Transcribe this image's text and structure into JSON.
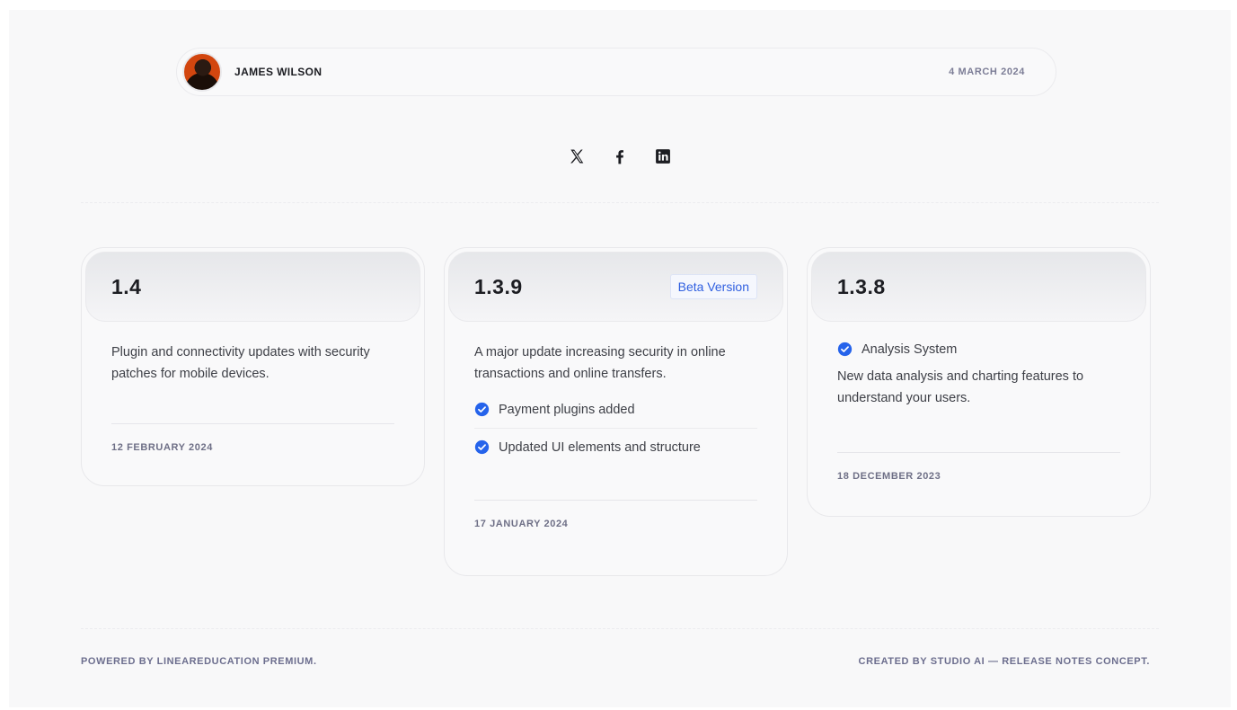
{
  "author": {
    "name": "JAMES WILSON",
    "date": "4 MARCH 2024"
  },
  "social": [
    {
      "icon": "x-twitter-icon"
    },
    {
      "icon": "facebook-icon"
    },
    {
      "icon": "linkedin-icon"
    }
  ],
  "releases": [
    {
      "version": "1.4",
      "description": "Plugin and connectivity updates with security patches for mobile devices.",
      "date": "12 FEBRUARY 2024"
    },
    {
      "version": "1.3.9",
      "badge": "Beta Version",
      "description": "A major update increasing security in online transactions and online transfers.",
      "features": [
        "Payment plugins added",
        "Updated UI elements and structure"
      ],
      "date": "17 JANUARY 2024"
    },
    {
      "version": "1.3.8",
      "feature": "Analysis System",
      "description": "New data analysis and charting features to understand your users.",
      "date": "18 DECEMBER 2023"
    }
  ],
  "footer": {
    "left": "POWERED BY LINEAREDUCATION PREMIUM.",
    "right": "CREATED BY STUDIO AI — RELEASE NOTES CONCEPT."
  },
  "colors": {
    "accent": "#2f5fe0",
    "check": "#2563eb",
    "avatar_bg": "#d2460f"
  }
}
